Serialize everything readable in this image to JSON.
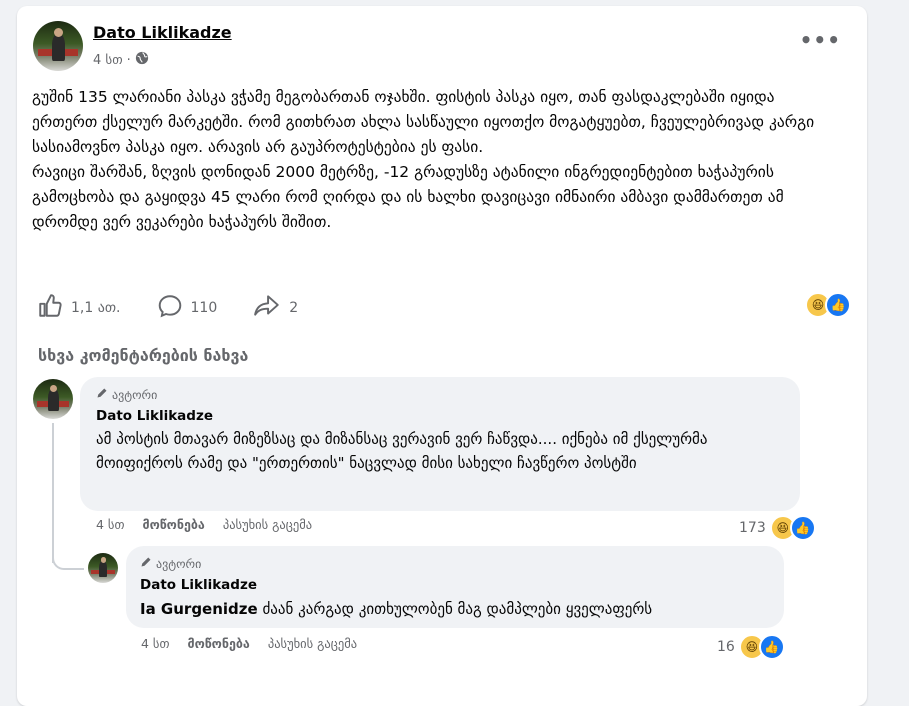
{
  "post": {
    "author": "Dato Liklikadze",
    "time": "4 სთ",
    "dot": "·",
    "paragraph1": "გუშინ 135 ლარიანი პასკა ვჭამე მეგობართან ოჯახში. ფისტის პასკა იყო, თან ფასდაკლებაში იყიდა ერთერთ ქსელურ  მარკეტში. რომ გითხრათ ახლა სასწაული იყოთქო მოგატყუებთ, ჩვეულებრივად კარგი სასიამოვნო პასკა იყო. არავის არ გაუპროტესტებია ეს ფასი.",
    "paragraph2": "რავიცი შარშან, ზღვის დონიდან 2000 მეტრზე, -12 გრადუსზე ატანილი ინგრედიენტებით ხაჭაპურის გამოცხობა და გაყიდვა 45 ლარი რომ ღირდა და ის ხალხი დავიცავი იმნაირი ამბავი დამმართეთ ამ დრომდე ვერ ვეკარები ხაჭაპურს შიშით.",
    "likes": "1,1 ათ.",
    "comments": "110",
    "shares": "2"
  },
  "view_more_comments": "სხვა კომენტარების ნახვა",
  "comment1": {
    "badge": "ავტორი",
    "author": "Dato Liklikadze",
    "text": "ამ პოსტის მთავარ მიზეზსაც და მიზანსაც ვერავინ ვერ ჩაწვდა.... იქნება იმ ქსელურმა მოიფიქროს რამე და \"ერთერთის\" ნაცვლად მისი სახელი ჩავწერო პოსტში",
    "time": "4 სთ",
    "like": "მოწონება",
    "reply": "პასუხის გაცემა",
    "reactions": "173"
  },
  "comment2": {
    "badge": "ავტორი",
    "author": "Dato Liklikadze",
    "mention": "Ia Gurgenidze",
    "text": " ძაან კარგად კითხულობენ მაგ დამპლები ყველაფერს",
    "time": "4 სთ",
    "like": "მოწონება",
    "reply": "პასუხის გაცემა",
    "reactions": "16"
  },
  "icons": {
    "globe": "globe-icon",
    "more": "more-icon",
    "like": "like-icon",
    "comment": "comment-icon",
    "share": "share-icon",
    "pencil": "pencil-icon"
  },
  "colors": {
    "background": "#f0f2f5",
    "card": "#ffffff",
    "secondary_text": "#65676b",
    "accent": "#1877f2"
  }
}
